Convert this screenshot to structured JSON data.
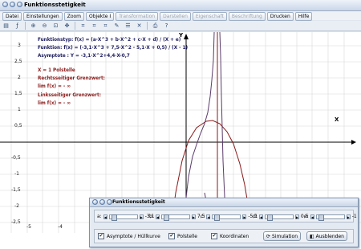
{
  "window": {
    "title": "Funktionsstetigkeit"
  },
  "menu": [
    {
      "label": "Datei",
      "enabled": true
    },
    {
      "label": "Einstellungen",
      "enabled": true
    },
    {
      "label": "Zoom",
      "enabled": true
    },
    {
      "label": "Objekte I",
      "enabled": true
    },
    {
      "label": "Transformation",
      "enabled": false
    },
    {
      "label": "Darstellen",
      "enabled": false
    },
    {
      "label": "Eigenschaft",
      "enabled": false
    },
    {
      "label": "Beschriftung",
      "enabled": false
    },
    {
      "label": "Drucken",
      "enabled": true
    },
    {
      "label": "Hilfe",
      "enabled": true
    }
  ],
  "toolbar": [
    "new-icon",
    "function-icon",
    "zoom-in-icon",
    "zoom-out-icon",
    "zoom-fit-icon",
    "move-icon",
    "crop-icon",
    "crop2-icon",
    "crop3-icon",
    "edit-icon",
    "list-icon",
    "delete-icon",
    "print-icon",
    "help-icon"
  ],
  "plot": {
    "y_ticks": [
      "3",
      "2,5",
      "2",
      "1,5",
      "1",
      "0,5",
      "-0,5",
      "-1",
      "-1,5",
      "-2",
      "-2,5"
    ],
    "x_ticks": [
      "-5",
      "-4",
      "-3",
      "-2",
      "-1",
      "1",
      "2",
      "3",
      "4",
      "5"
    ],
    "x_axis_label": "X",
    "y_axis_label": "Y",
    "colors": {
      "background": "#ffffff",
      "grid": "#d8d8d8",
      "axis": "#000000",
      "curve": "#5a3a6a",
      "asymptote": "#8a1a1a",
      "navy_text": "#1c1c60",
      "red_text": "#8a1a1a"
    }
  },
  "info": {
    "line1": "Funktionstyp: f(x) = (a·X^3 + b·X^2 + c·X + d) / (X + e)",
    "line2": "Funktion: f(x) = (-3,1·X^3 + 7,5·X^2 - 5,1·X + 0,5) / (X - 1)",
    "line3": "Asymptote : Y = -3,1·X^2+4,4·X-0,7",
    "line4": "X = 1 Polstelle",
    "line5": "Rechtsseitiger Grenzwert:",
    "line6": "lim f(x) = - ∞",
    "line7": "Linksseitiger Grenzwert:",
    "line8": "lim f(x) = - ∞"
  },
  "panel": {
    "title": "Funktionsstetigkeit",
    "params": [
      {
        "name": "a:",
        "value": "-3,1"
      },
      {
        "name": "b:",
        "value": "7,5"
      },
      {
        "name": "c:",
        "value": "-5,1"
      },
      {
        "name": "d:",
        "value": "0,5"
      },
      {
        "name": "e:",
        "value": "-1"
      }
    ],
    "checkboxes": [
      {
        "label": "Asymptote / Hüllkurve",
        "checked": true
      },
      {
        "label": "Polstelle",
        "checked": true
      },
      {
        "label": "Koordinaten",
        "checked": true
      }
    ],
    "simulation_label": "Simulation",
    "hide_label": "Ausblenden"
  }
}
